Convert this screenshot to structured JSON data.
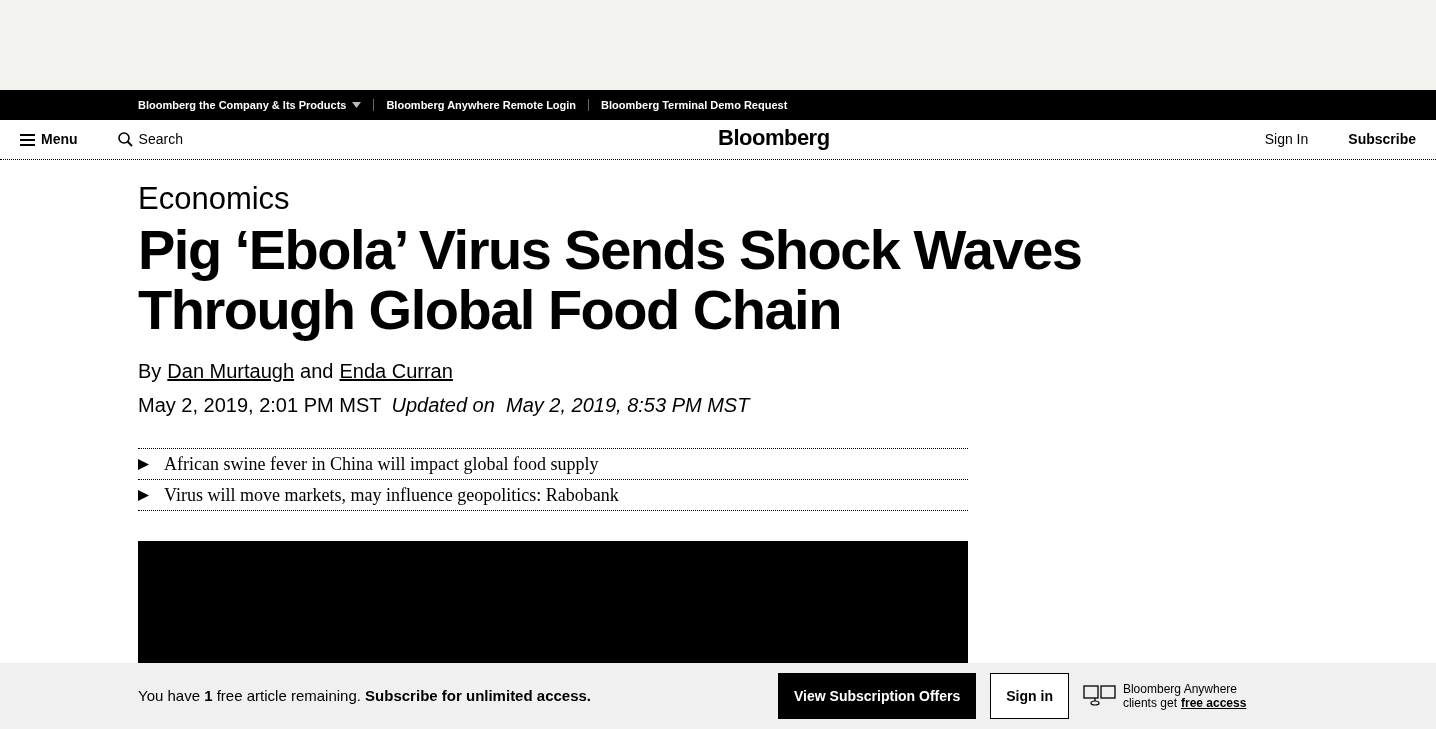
{
  "top_bar": {
    "links": [
      {
        "label": "Bloomberg the Company & Its Products",
        "has_dropdown": true
      },
      {
        "label": "Bloomberg Anywhere Remote Login",
        "has_dropdown": false
      },
      {
        "label": "Bloomberg Terminal Demo Request",
        "has_dropdown": false
      }
    ]
  },
  "nav": {
    "menu": "Menu",
    "search": "Search",
    "logo": "Bloomberg",
    "sign_in": "Sign In",
    "subscribe": "Subscribe"
  },
  "article": {
    "section": "Economics",
    "headline": "Pig ‘Ebola’ Virus Sends Shock Waves Through Global Food Chain",
    "byline_prefix": "By",
    "authors": [
      "Dan Murtaugh",
      "Enda Curran"
    ],
    "byline_joiner": "and",
    "published": "May 2, 2019, 2:01 PM MST",
    "updated": "Updated on  May 2, 2019, 8:53 PM MST",
    "takeaways": [
      "African swine fever in China will impact global food supply",
      "Virus will move markets, may influence geopolitics: Rabobank"
    ]
  },
  "paywall": {
    "message": "You have **1** free article remaining. **Subscribe for unlimited access.**",
    "offers_button": "View Subscription Offers",
    "sign_in_button": "Sign in",
    "anywhere_lines": [
      "Bloomberg Anywhere",
      "clients get"
    ],
    "anywhere_link": "free access"
  }
}
